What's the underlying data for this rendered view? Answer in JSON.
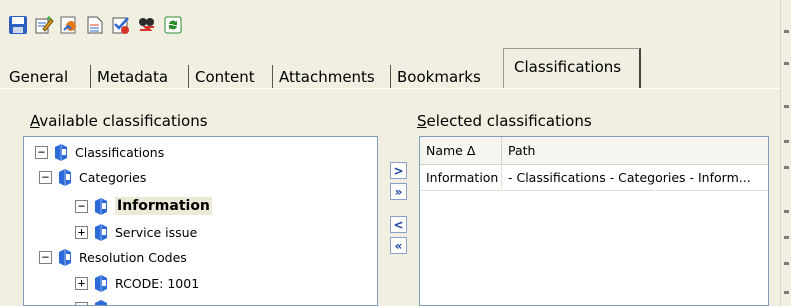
{
  "toolbar": {
    "buttons": [
      {
        "name": "save-icon"
      },
      {
        "name": "edit-notes-icon"
      },
      {
        "name": "assign-icon"
      },
      {
        "name": "document-icon"
      },
      {
        "name": "checkout-icon"
      },
      {
        "name": "transfer-icon"
      },
      {
        "name": "refresh-icon"
      }
    ]
  },
  "tabs": [
    {
      "label": "General"
    },
    {
      "label": "Metadata"
    },
    {
      "label": "Content"
    },
    {
      "label": "Attachments"
    },
    {
      "label": "Bookmarks"
    },
    {
      "label": "Classifications",
      "active": true
    }
  ],
  "available": {
    "label_accel": "A",
    "label_rest": "vailable classifications",
    "tree": [
      {
        "label": "Classifications",
        "expander": "−",
        "level": 0
      },
      {
        "label": "Categories",
        "expander": "−",
        "level": 1
      },
      {
        "label": "Information",
        "expander": "−",
        "level": 2,
        "selected": true
      },
      {
        "label": "Service issue",
        "expander": "+",
        "level": 2
      },
      {
        "label": "Resolution Codes",
        "expander": "−",
        "level": 1
      },
      {
        "label": "RCODE: 1001",
        "expander": "+",
        "level": 2
      }
    ]
  },
  "selected": {
    "label_accel": "S",
    "label_rest": "elected classifications",
    "columns": {
      "name": "Name",
      "sort_indicator": "Δ",
      "path": "Path"
    },
    "rows": [
      {
        "name": "Information",
        "path": "- Classifications - Categories - Inform..."
      }
    ]
  },
  "mover": {
    "add": ">",
    "add_all": "»",
    "remove": "<",
    "remove_all": "«"
  },
  "colors": {
    "background": "#f1efe2",
    "box_border": "#7f9db9",
    "icon_blue": "#2b6ad8"
  }
}
